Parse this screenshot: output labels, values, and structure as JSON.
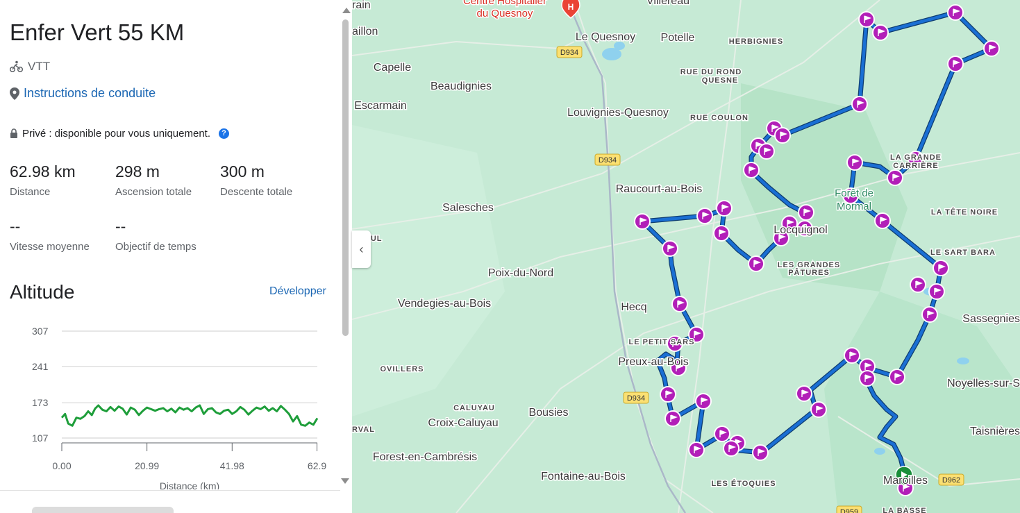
{
  "route": {
    "title": "Enfer Vert 55 KM",
    "type": "VTT",
    "directions_link": "Instructions de conduite",
    "privacy": "Privé : disponible pour vous uniquement."
  },
  "stats": [
    {
      "value": "62.98 km",
      "label": "Distance"
    },
    {
      "value": "298 m",
      "label": "Ascension totale"
    },
    {
      "value": "300 m",
      "label": "Descente totale"
    },
    {
      "value": "--",
      "label": "Vitesse moyenne"
    },
    {
      "value": "--",
      "label": "Objectif de temps"
    }
  ],
  "elevation": {
    "title": "Altitude",
    "expand_label": "Développer",
    "xlabel": "Distance (km)",
    "y_ticks": [
      "307",
      "241",
      "173",
      "107"
    ],
    "x_ticks": [
      "0.00",
      "20.99",
      "41.98",
      "62.9"
    ]
  },
  "chart_data": {
    "type": "line",
    "title": "Altitude",
    "xlabel": "Distance (km)",
    "ylabel": "",
    "xlim": [
      0,
      62.98
    ],
    "ylim": [
      107,
      307
    ],
    "y_ticks": [
      107,
      173,
      241,
      307
    ],
    "x_ticks": [
      0.0,
      20.99,
      41.98,
      62.9
    ],
    "grid": true,
    "series": [
      {
        "color": "#1e9e3a",
        "x": [
          0,
          0.8,
          1.6,
          2.6,
          3.6,
          4.6,
          5.6,
          6.5,
          7.4,
          8.2,
          9.0,
          10.0,
          11.0,
          12.0,
          13.0,
          14.0,
          15.0,
          16.0,
          17.0,
          18.0,
          19.0,
          20.0,
          21.0,
          22.0,
          23.0,
          24.0,
          25.0,
          26.0,
          27.0,
          28.0,
          29.0,
          30.0,
          31.0,
          32.0,
          33.0,
          34.0,
          35.0,
          36.0,
          37.0,
          38.0,
          39.0,
          40.0,
          41.0,
          42.0,
          43.0,
          44.0,
          45.0,
          46.0,
          47.0,
          48.0,
          49.0,
          50.0,
          51.0,
          52.0,
          53.0,
          54.0,
          55.0,
          56.0,
          57.0,
          58.0,
          59.0,
          60.0,
          61.0,
          62.0,
          62.98
        ],
        "y": [
          145,
          152,
          134,
          130,
          145,
          143,
          148,
          157,
          150,
          162,
          168,
          160,
          157,
          165,
          158,
          166,
          162,
          151,
          164,
          160,
          150,
          158,
          164,
          161,
          158,
          161,
          163,
          157,
          162,
          155,
          164,
          160,
          163,
          157,
          164,
          168,
          152,
          161,
          163,
          155,
          152,
          158,
          160,
          152,
          157,
          165,
          160,
          151,
          158,
          164,
          161,
          166,
          158,
          163,
          157,
          167,
          160,
          152,
          138,
          148,
          132,
          130,
          136,
          132,
          144
        ]
      }
    ]
  },
  "map": {
    "places": [
      {
        "name": "Centre Hospitalier",
        "kind": "poi"
      },
      {
        "name": "du Quesnoy",
        "kind": "poi"
      },
      {
        "name": "Villereau",
        "kind": "town"
      },
      {
        "name": "Le Quesnoy",
        "kind": "town"
      },
      {
        "name": "Potelle",
        "kind": "town"
      },
      {
        "name": "HERBIGNIES",
        "kind": "locality"
      },
      {
        "name": "Capelle",
        "kind": "town"
      },
      {
        "name": "Beaudignies",
        "kind": "town"
      },
      {
        "name": "RUE DU ROND",
        "kind": "locality"
      },
      {
        "name": "QUESNE",
        "kind": "locality"
      },
      {
        "name": "Escarmain",
        "kind": "town"
      },
      {
        "name": "Louvignies-Quesnoy",
        "kind": "town"
      },
      {
        "name": "RUE COULON",
        "kind": "locality"
      },
      {
        "name": "Raucourt-au-Bois",
        "kind": "town"
      },
      {
        "name": "Salesches",
        "kind": "town"
      },
      {
        "name": "Forêt de",
        "kind": "forest"
      },
      {
        "name": "Mormal",
        "kind": "forest"
      },
      {
        "name": "LA GRANDE",
        "kind": "locality"
      },
      {
        "name": "CARRIÈRE",
        "kind": "locality"
      },
      {
        "name": "LA TÊTE NOIRE",
        "kind": "locality"
      },
      {
        "name": "Locquignol",
        "kind": "town"
      },
      {
        "name": "LES GRANDES",
        "kind": "locality"
      },
      {
        "name": "PÂTURES",
        "kind": "locality"
      },
      {
        "name": "LE SART BARA",
        "kind": "locality"
      },
      {
        "name": "Poix-du-Nord",
        "kind": "town"
      },
      {
        "name": "Vendegies-au-Bois",
        "kind": "town"
      },
      {
        "name": "Hecq",
        "kind": "town"
      },
      {
        "name": "Sassegnies",
        "kind": "town"
      },
      {
        "name": "LE PETIT SARS",
        "kind": "locality"
      },
      {
        "name": "Preux-au-Bois",
        "kind": "town"
      },
      {
        "name": "OVILLERS",
        "kind": "locality"
      },
      {
        "name": "Noyelles-sur-S",
        "kind": "town"
      },
      {
        "name": "CALUYAU",
        "kind": "locality"
      },
      {
        "name": "Croix-Caluyau",
        "kind": "town"
      },
      {
        "name": "Bousies",
        "kind": "town"
      },
      {
        "name": "Taisnières",
        "kind": "town"
      },
      {
        "name": "RVAL",
        "kind": "locality"
      },
      {
        "name": "Forest-en-Cambrésis",
        "kind": "town"
      },
      {
        "name": "Fontaine-au-Bois",
        "kind": "town"
      },
      {
        "name": "LES ÉTOQUIES",
        "kind": "locality"
      },
      {
        "name": "Maroilles",
        "kind": "town"
      },
      {
        "name": "LA BASSE",
        "kind": "locality"
      },
      {
        "name": "GNEUL",
        "kind": "locality"
      },
      {
        "name": "aillon",
        "kind": "town"
      },
      {
        "name": "rain",
        "kind": "town"
      }
    ],
    "road_badges": [
      "D934",
      "D934",
      "D934",
      "D962",
      "D959"
    ],
    "colors": {
      "route": "#1a6fd4",
      "marker": "#b21fb8",
      "start": "#1a8e3a",
      "background": "#bfe8cf"
    }
  }
}
